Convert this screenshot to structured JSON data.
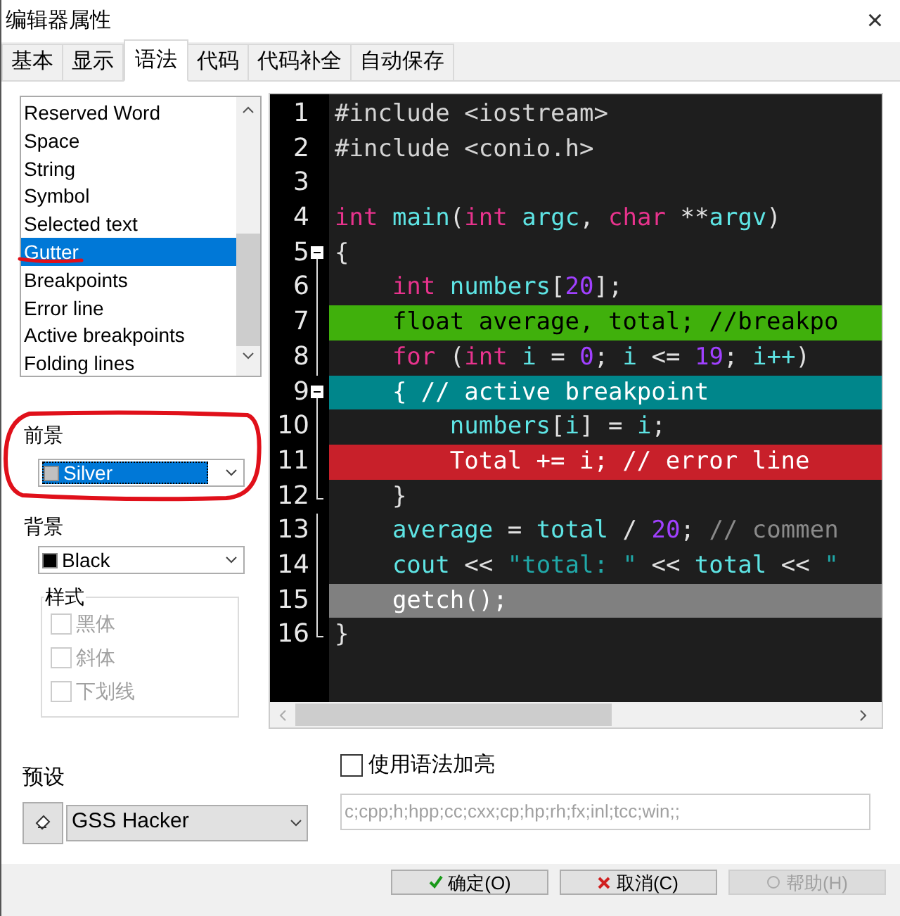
{
  "window": {
    "title": "编辑器属性",
    "close": "×"
  },
  "tabs": [
    {
      "label": "基本",
      "selected": false
    },
    {
      "label": "显示",
      "selected": false
    },
    {
      "label": "语法",
      "selected": true
    },
    {
      "label": "代码",
      "selected": false
    },
    {
      "label": "代码补全",
      "selected": false
    },
    {
      "label": "自动保存",
      "selected": false
    }
  ],
  "element_list": {
    "items": [
      {
        "label": "Reserved Word",
        "selected": false
      },
      {
        "label": "Space",
        "selected": false
      },
      {
        "label": "String",
        "selected": false
      },
      {
        "label": "Symbol",
        "selected": false
      },
      {
        "label": "Selected text",
        "selected": false
      },
      {
        "label": "Gutter",
        "selected": true
      },
      {
        "label": "Breakpoints",
        "selected": false
      },
      {
        "label": "Error line",
        "selected": false
      },
      {
        "label": "Active breakpoints",
        "selected": false
      },
      {
        "label": "Folding lines",
        "selected": false
      }
    ]
  },
  "foreground": {
    "label": "前景",
    "value": "Silver",
    "color": "#c0c0c0",
    "focused": true
  },
  "background": {
    "label": "背景",
    "value": "Black",
    "color": "#000000",
    "focused": false
  },
  "style_group": {
    "title": "样式",
    "options": [
      {
        "label": "黑体",
        "checked": false,
        "disabled": true
      },
      {
        "label": "斜体",
        "checked": false,
        "disabled": true
      },
      {
        "label": "下划线",
        "checked": false,
        "disabled": true
      }
    ]
  },
  "editor": {
    "lines": [
      {
        "number": "1",
        "kind": "plain",
        "breakpoint": false,
        "active_breakpoint": false,
        "error": false,
        "selected": false,
        "tokens": [
          {
            "text": "#include <iostream>",
            "kind": "directive"
          }
        ]
      },
      {
        "number": "2",
        "kind": "plain",
        "breakpoint": false,
        "active_breakpoint": false,
        "error": false,
        "selected": false,
        "tokens": [
          {
            "text": "#include <conio.h>",
            "kind": "directive"
          }
        ]
      },
      {
        "number": "3",
        "kind": "plain",
        "breakpoint": false,
        "active_breakpoint": false,
        "error": false,
        "selected": false
      },
      {
        "number": "4",
        "kind": "plain",
        "breakpoint": false,
        "active_breakpoint": false,
        "error": false,
        "selected": false,
        "tokens": [
          {
            "text": "int",
            "kind": "keyword"
          },
          {
            "text": " main",
            "kind": "ident"
          },
          {
            "text": "(",
            "kind": "symbol"
          },
          {
            "text": "int",
            "kind": "keyword"
          },
          {
            "text": " argc",
            "kind": "ident"
          },
          {
            "text": ", ",
            "kind": "symbol"
          },
          {
            "text": "char",
            "kind": "keyword"
          },
          {
            "text": " **",
            "kind": "symbol"
          },
          {
            "text": "argv",
            "kind": "ident"
          },
          {
            "text": ")",
            "kind": "symbol"
          }
        ]
      },
      {
        "number": "5",
        "kind": "fold-start",
        "breakpoint": false,
        "active_breakpoint": false,
        "error": false,
        "selected": false,
        "tokens": [
          {
            "text": "{",
            "kind": "symbol"
          }
        ]
      },
      {
        "number": "6",
        "kind": "fold-body",
        "breakpoint": false,
        "active_breakpoint": false,
        "error": false,
        "selected": false,
        "tokens": [
          {
            "text": "    int",
            "kind": "keyword"
          },
          {
            "text": " numbers",
            "kind": "ident"
          },
          {
            "text": "[",
            "kind": "symbol"
          },
          {
            "text": "20",
            "kind": "number"
          },
          {
            "text": "];",
            "kind": "symbol"
          }
        ]
      },
      {
        "number": "7",
        "kind": "fold-body",
        "breakpoint": true,
        "active_breakpoint": false,
        "error": false,
        "selected": false,
        "tokens": [
          {
            "text": "    float average, total; //breakpo",
            "kind": "plain"
          }
        ]
      },
      {
        "number": "8",
        "kind": "fold-body",
        "breakpoint": false,
        "active_breakpoint": false,
        "error": false,
        "selected": false,
        "tokens": [
          {
            "text": "    for",
            "kind": "keyword"
          },
          {
            "text": " (",
            "kind": "symbol"
          },
          {
            "text": "int",
            "kind": "keyword"
          },
          {
            "text": " i",
            "kind": "ident"
          },
          {
            "text": " = ",
            "kind": "symbol"
          },
          {
            "text": "0",
            "kind": "number"
          },
          {
            "text": "; ",
            "kind": "symbol"
          },
          {
            "text": "i",
            "kind": "ident"
          },
          {
            "text": " <= ",
            "kind": "symbol"
          },
          {
            "text": "19",
            "kind": "number"
          },
          {
            "text": "; ",
            "kind": "symbol"
          },
          {
            "text": "i++",
            "kind": "ident"
          },
          {
            "text": ")",
            "kind": "symbol"
          }
        ]
      },
      {
        "number": "9",
        "kind": "fold-start",
        "breakpoint": false,
        "active_breakpoint": true,
        "error": false,
        "selected": false,
        "tokens": [
          {
            "text": "    { // active breakpoint",
            "kind": "plain"
          }
        ]
      },
      {
        "number": "10",
        "kind": "fold-body",
        "breakpoint": false,
        "active_breakpoint": false,
        "error": false,
        "selected": false,
        "tokens": [
          {
            "text": "        numbers",
            "kind": "ident"
          },
          {
            "text": "[",
            "kind": "symbol"
          },
          {
            "text": "i",
            "kind": "ident"
          },
          {
            "text": "] = ",
            "kind": "symbol"
          },
          {
            "text": "i",
            "kind": "ident"
          },
          {
            "text": ";",
            "kind": "symbol"
          }
        ]
      },
      {
        "number": "11",
        "kind": "fold-body",
        "breakpoint": false,
        "active_breakpoint": false,
        "error": true,
        "selected": false,
        "tokens": [
          {
            "text": "        Total += i; // error line",
            "kind": "plain"
          }
        ]
      },
      {
        "number": "12",
        "kind": "fold-end",
        "breakpoint": false,
        "active_breakpoint": false,
        "error": false,
        "selected": false,
        "tokens": [
          {
            "text": "    }",
            "kind": "symbol"
          }
        ]
      },
      {
        "number": "13",
        "kind": "fold-body",
        "breakpoint": false,
        "active_breakpoint": false,
        "error": false,
        "selected": false,
        "tokens": [
          {
            "text": "    average",
            "kind": "ident"
          },
          {
            "text": " = ",
            "kind": "symbol"
          },
          {
            "text": "total",
            "kind": "ident"
          },
          {
            "text": " / ",
            "kind": "symbol"
          },
          {
            "text": "20",
            "kind": "number"
          },
          {
            "text": "; ",
            "kind": "symbol"
          },
          {
            "text": "// commen",
            "kind": "comment"
          }
        ]
      },
      {
        "number": "14",
        "kind": "fold-body",
        "breakpoint": false,
        "active_breakpoint": false,
        "error": false,
        "selected": false,
        "tokens": [
          {
            "text": "    cout",
            "kind": "ident"
          },
          {
            "text": " << ",
            "kind": "symbol"
          },
          {
            "text": "\"total: \"",
            "kind": "string"
          },
          {
            "text": " << ",
            "kind": "symbol"
          },
          {
            "text": "total",
            "kind": "ident"
          },
          {
            "text": " << ",
            "kind": "symbol"
          },
          {
            "text": "\"",
            "kind": "string"
          }
        ]
      },
      {
        "number": "15",
        "kind": "fold-body",
        "breakpoint": false,
        "active_breakpoint": false,
        "error": false,
        "selected": true,
        "tokens": [
          {
            "text": "    getch();",
            "kind": "plain"
          }
        ]
      },
      {
        "number": "16",
        "kind": "fold-end",
        "breakpoint": false,
        "active_breakpoint": false,
        "error": false,
        "selected": false,
        "tokens": [
          {
            "text": "}",
            "kind": "symbol"
          }
        ]
      }
    ]
  },
  "preset": {
    "label": "预设",
    "value": "GSS Hacker"
  },
  "syntax_highlight": {
    "label": "使用语法加亮",
    "checked": false
  },
  "extensions": {
    "value": "c;cpp;h;hpp;cc;cxx;cp;hp;rh;fx;inl;tcc;win;;",
    "disabled": true
  },
  "buttons": [
    {
      "label": "确定(O)",
      "kind": "ok",
      "disabled": false
    },
    {
      "label": "取消(C)",
      "kind": "cancel",
      "disabled": false
    },
    {
      "label": "帮助(H)",
      "kind": "help",
      "disabled": true
    }
  ],
  "annotations": {
    "underline": true,
    "circle": true
  }
}
